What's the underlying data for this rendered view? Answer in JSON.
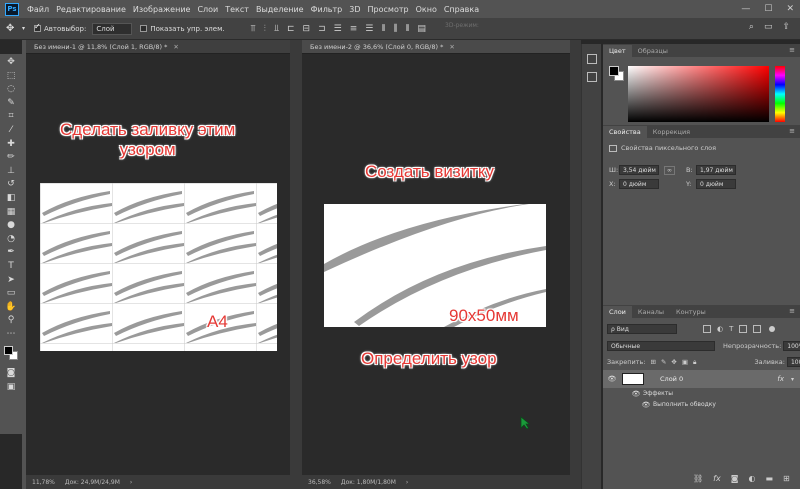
{
  "app": {
    "logo": "Ps",
    "menu": [
      "Файл",
      "Редактирование",
      "Изображение",
      "Слои",
      "Текст",
      "Выделение",
      "Фильтр",
      "3D",
      "Просмотр",
      "Окно",
      "Справка"
    ],
    "window_controls": [
      "—",
      "☐",
      "✕"
    ]
  },
  "options": {
    "autoselect_label": "Автовыбор:",
    "autoselect_value": "Слой",
    "show_controls_label": "Показать упр. элем.",
    "mode3d_label": "3D-режим:"
  },
  "documents": [
    {
      "tab_title": "Без имени-1 @ 11,8% (Слой 1, RGB/8) *",
      "zoom": "11,78%",
      "doc_info": "Док: 24,9M/24,9M"
    },
    {
      "tab_title": "Без имени-2 @ 36,6% (Слой 0, RGB/8) *",
      "zoom": "36,58%",
      "doc_info": "Док: 1,80M/1,80M"
    }
  ],
  "annotations": {
    "fill_line1": "Сделать заливку этим",
    "fill_line2": "узором",
    "a4": "A4",
    "create_card": "Создать визитку",
    "size": "90x50мм",
    "define_pattern": "Определить узор"
  },
  "color_panel": {
    "tabs": [
      "Цвет",
      "Образцы"
    ],
    "hue_color": "#ff0000"
  },
  "properties": {
    "tabs": [
      "Свойства",
      "Коррекция"
    ],
    "title": "Свойства пиксельного слоя",
    "w_label": "Ш:",
    "w_value": "3,54 дюйм",
    "h_label": "В:",
    "h_value": "1,97 дюйм",
    "x_label": "X:",
    "x_value": "0 дюйм",
    "y_label": "Y:",
    "y_value": "0 дюйм"
  },
  "layers": {
    "tabs": [
      "Слои",
      "Каналы",
      "Контуры"
    ],
    "filter_label": "ρ Вид",
    "blend_mode": "Обычные",
    "opacity_label": "Непрозрачность:",
    "opacity_value": "100%",
    "lock_label": "Закрепить:",
    "fill_label": "Заливка:",
    "fill_value": "100%",
    "layer_name": "Слой 0",
    "fx": "fx",
    "effects_label": "Эффекты",
    "stroke_label": "Выполнить обводку"
  }
}
